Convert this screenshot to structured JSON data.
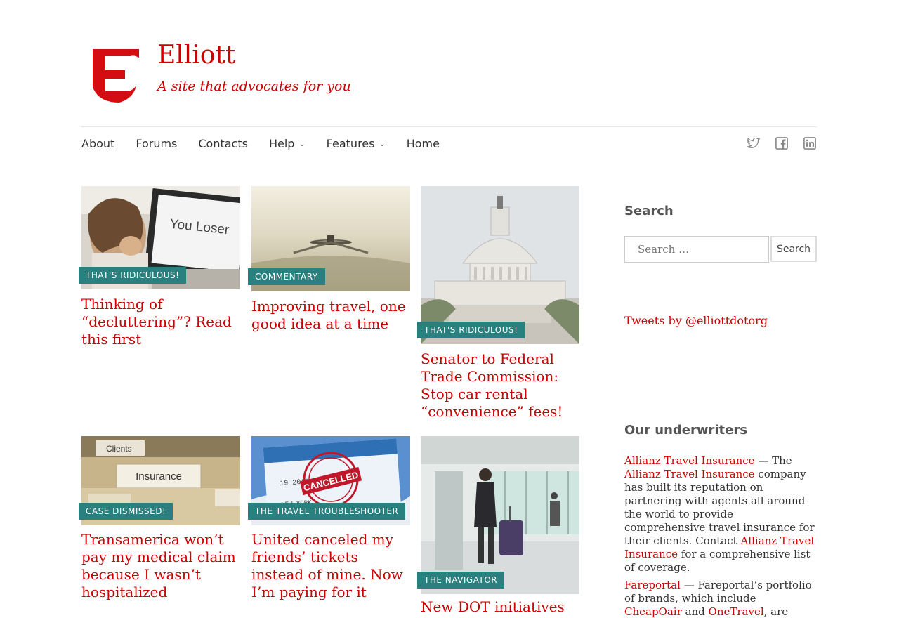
{
  "site": {
    "title": "Elliott",
    "tagline": "A site that advocates for you",
    "brand_color": "#cc0000",
    "badge_color": "#2a7f7f"
  },
  "nav": {
    "items": [
      {
        "label": "About",
        "has_dropdown": false
      },
      {
        "label": "Forums",
        "has_dropdown": false
      },
      {
        "label": "Contacts",
        "has_dropdown": false
      },
      {
        "label": "Help",
        "has_dropdown": true
      },
      {
        "label": "Features",
        "has_dropdown": true
      },
      {
        "label": "Home",
        "has_dropdown": false
      }
    ],
    "social_icons": [
      "twitter-icon",
      "facebook-icon",
      "linkedin-icon"
    ]
  },
  "posts": [
    {
      "category": "THAT'S RIDICULOUS!",
      "title": "Thinking of “decluttering”? Read this first",
      "image_text": "You Loser"
    },
    {
      "category": "COMMENTARY",
      "title": "Improving travel, one good idea at a time"
    },
    {
      "category": "THAT'S RIDICULOUS!",
      "title": "Senator to Federal Trade Commission: Stop car rental “convenience” fees!"
    },
    {
      "category": "CASE DISMISSED!",
      "title": "Transamerica won’t pay my medical claim because I wasn’t hospitalized",
      "image_text": "Insurance"
    },
    {
      "category": "THE TRAVEL TROUBLESHOOTER",
      "title": "United canceled my friends’ tickets instead of mine. Now I’m paying for it",
      "image_text": "CANCELLED"
    },
    {
      "category": "THE NAVIGATOR",
      "title": "New DOT initiatives"
    }
  ],
  "sidebar": {
    "search_heading": "Search",
    "search_placeholder": "Search …",
    "search_button": "Search",
    "tweets_link": "Tweets by @elliottdotorg",
    "underwriters_heading": "Our underwriters",
    "allianz": {
      "link": "Allianz Travel Insurance",
      "dash": " — The ",
      "link2": "Allianz Travel Insurance",
      "body": " company has built its reputation on partnering with agents all around the world to provide comprehensive travel insurance for their clients. Contact ",
      "link3": "Allianz Travel Insurance",
      "tail": " for a comprehensive list of coverage."
    },
    "fareportal": {
      "link": "Fareportal",
      "body": " — Fareportal’s portfolio of brands, which include ",
      "link2": "CheapOair",
      "and": " and ",
      "link3": "OneTravel",
      "tail": ", are dedicated to helping"
    }
  }
}
